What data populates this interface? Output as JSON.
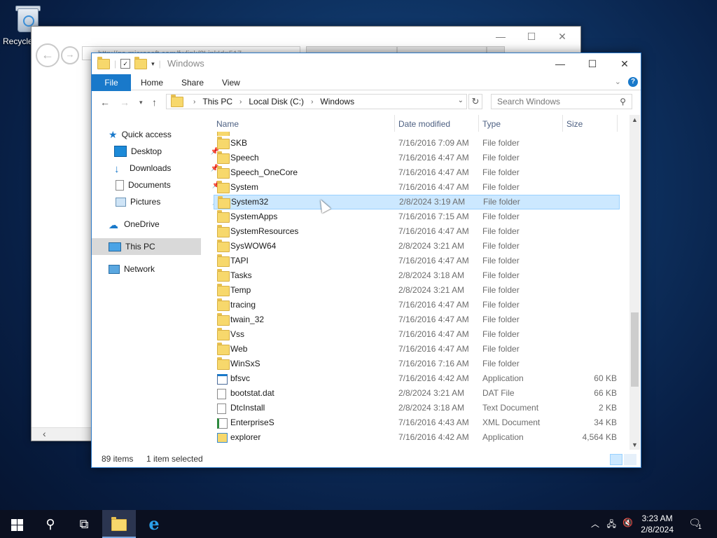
{
  "desktop": {
    "recycle_label": "Recycle Bin"
  },
  "ie": {
    "address": "http://go.microsoft.com/fwlink/?LinkId=517"
  },
  "explorer": {
    "title": "Windows",
    "ribbon": {
      "file": "File",
      "home": "Home",
      "share": "Share",
      "view": "View"
    },
    "breadcrumb": [
      "This PC",
      "Local Disk (C:)",
      "Windows"
    ],
    "search_placeholder": "Search Windows",
    "nav": {
      "quick_access": "Quick access",
      "desktop": "Desktop",
      "downloads": "Downloads",
      "documents": "Documents",
      "pictures": "Pictures",
      "onedrive": "OneDrive",
      "this_pc": "This PC",
      "network": "Network"
    },
    "columns": {
      "name": "Name",
      "date": "Date modified",
      "type": "Type",
      "size": "Size"
    },
    "rows": [
      {
        "name": "SKB",
        "date": "7/16/2016 7:09 AM",
        "type": "File folder",
        "size": "",
        "icon": "folder"
      },
      {
        "name": "Speech",
        "date": "7/16/2016 4:47 AM",
        "type": "File folder",
        "size": "",
        "icon": "folder"
      },
      {
        "name": "Speech_OneCore",
        "date": "7/16/2016 4:47 AM",
        "type": "File folder",
        "size": "",
        "icon": "folder"
      },
      {
        "name": "System",
        "date": "7/16/2016 4:47 AM",
        "type": "File folder",
        "size": "",
        "icon": "folder"
      },
      {
        "name": "System32",
        "date": "2/8/2024 3:19 AM",
        "type": "File folder",
        "size": "",
        "icon": "folder",
        "selected": true
      },
      {
        "name": "SystemApps",
        "date": "7/16/2016 7:15 AM",
        "type": "File folder",
        "size": "",
        "icon": "folder"
      },
      {
        "name": "SystemResources",
        "date": "7/16/2016 4:47 AM",
        "type": "File folder",
        "size": "",
        "icon": "folder"
      },
      {
        "name": "SysWOW64",
        "date": "2/8/2024 3:21 AM",
        "type": "File folder",
        "size": "",
        "icon": "folder"
      },
      {
        "name": "TAPI",
        "date": "7/16/2016 4:47 AM",
        "type": "File folder",
        "size": "",
        "icon": "folder"
      },
      {
        "name": "Tasks",
        "date": "2/8/2024 3:18 AM",
        "type": "File folder",
        "size": "",
        "icon": "folder"
      },
      {
        "name": "Temp",
        "date": "2/8/2024 3:21 AM",
        "type": "File folder",
        "size": "",
        "icon": "folder"
      },
      {
        "name": "tracing",
        "date": "7/16/2016 4:47 AM",
        "type": "File folder",
        "size": "",
        "icon": "folder"
      },
      {
        "name": "twain_32",
        "date": "7/16/2016 4:47 AM",
        "type": "File folder",
        "size": "",
        "icon": "folder"
      },
      {
        "name": "Vss",
        "date": "7/16/2016 4:47 AM",
        "type": "File folder",
        "size": "",
        "icon": "folder"
      },
      {
        "name": "Web",
        "date": "7/16/2016 4:47 AM",
        "type": "File folder",
        "size": "",
        "icon": "folder"
      },
      {
        "name": "WinSxS",
        "date": "7/16/2016 7:16 AM",
        "type": "File folder",
        "size": "",
        "icon": "folder"
      },
      {
        "name": "bfsvc",
        "date": "7/16/2016 4:42 AM",
        "type": "Application",
        "size": "60 KB",
        "icon": "app"
      },
      {
        "name": "bootstat.dat",
        "date": "2/8/2024 3:21 AM",
        "type": "DAT File",
        "size": "66 KB",
        "icon": "file"
      },
      {
        "name": "DtcInstall",
        "date": "2/8/2024 3:18 AM",
        "type": "Text Document",
        "size": "2 KB",
        "icon": "file"
      },
      {
        "name": "EnterpriseS",
        "date": "7/16/2016 4:43 AM",
        "type": "XML Document",
        "size": "34 KB",
        "icon": "xml"
      },
      {
        "name": "explorer",
        "date": "7/16/2016 4:42 AM",
        "type": "Application",
        "size": "4,564 KB",
        "icon": "explorer"
      }
    ],
    "status": {
      "items": "89 items",
      "selected": "1 item selected"
    }
  },
  "taskbar": {
    "time": "3:23 AM",
    "date": "2/8/2024",
    "notifications": "1"
  }
}
